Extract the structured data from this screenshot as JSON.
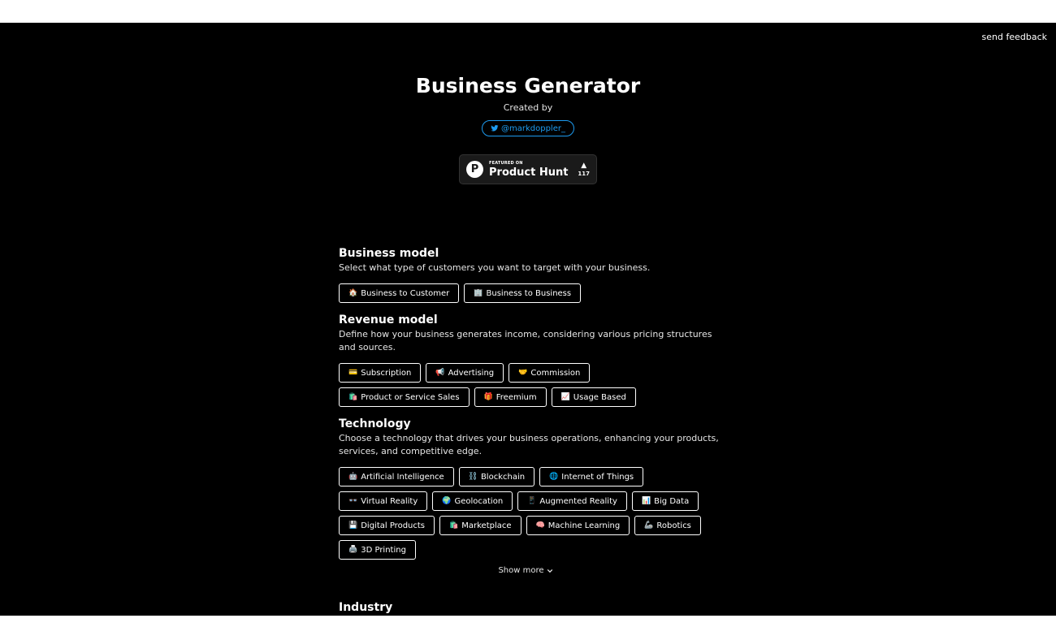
{
  "header": {
    "feedback": "send feedback",
    "title": "Business Generator",
    "created_by": "Created by",
    "twitter_handle": "@markdoppler_"
  },
  "product_hunt": {
    "small": "FEATURED ON",
    "big": "Product Hunt",
    "logo_letter": "P",
    "arrow": "▲",
    "votes": "117"
  },
  "sections": {
    "business_model": {
      "title": "Business model",
      "description": "Select what type of customers you want to target with your business.",
      "options": [
        {
          "icon": "🏠",
          "icon_name": "house-icon",
          "label": "Business to Customer"
        },
        {
          "icon": "🏢",
          "icon_name": "office-building-icon",
          "label": "Business to Business"
        }
      ]
    },
    "revenue_model": {
      "title": "Revenue model",
      "description": "Define how your business generates income, considering various pricing structures and sources.",
      "options": [
        {
          "icon": "💳",
          "icon_name": "credit-card-icon",
          "label": "Subscription"
        },
        {
          "icon": "📢",
          "icon_name": "megaphone-icon",
          "label": "Advertising"
        },
        {
          "icon": "🤝",
          "icon_name": "handshake-icon",
          "label": "Commission"
        },
        {
          "icon": "🛍️",
          "icon_name": "shopping-bags-icon",
          "label": "Product or Service Sales"
        },
        {
          "icon": "🎁",
          "icon_name": "gift-icon",
          "label": "Freemium"
        },
        {
          "icon": "📈",
          "icon_name": "chart-up-icon",
          "label": "Usage Based"
        }
      ]
    },
    "technology": {
      "title": "Technology",
      "description": "Choose a technology that drives your business operations, enhancing your products, services, and competitive edge.",
      "options": [
        {
          "icon": "🤖",
          "icon_name": "robot-icon",
          "label": "Artificial Intelligence"
        },
        {
          "icon": "⛓️",
          "icon_name": "chain-icon",
          "label": "Blockchain"
        },
        {
          "icon": "🌐",
          "icon_name": "globe-icon",
          "label": "Internet of Things"
        },
        {
          "icon": "👓",
          "icon_name": "glasses-icon",
          "label": "Virtual Reality"
        },
        {
          "icon": "🌍",
          "icon_name": "earth-icon",
          "label": "Geolocation"
        },
        {
          "icon": "📱",
          "icon_name": "phone-icon",
          "label": "Augmented Reality"
        },
        {
          "icon": "📊",
          "icon_name": "bar-chart-icon",
          "label": "Big Data"
        },
        {
          "icon": "💾",
          "icon_name": "floppy-disk-icon",
          "label": "Digital Products"
        },
        {
          "icon": "🛍️",
          "icon_name": "shopping-bags-icon",
          "label": "Marketplace"
        },
        {
          "icon": "🧠",
          "icon_name": "brain-icon",
          "label": "Machine Learning"
        },
        {
          "icon": "🦾",
          "icon_name": "mechanical-arm-icon",
          "label": "Robotics"
        },
        {
          "icon": "🖨️",
          "icon_name": "printer-icon",
          "label": "3D Printing"
        }
      ],
      "show_more": "Show more"
    },
    "industry": {
      "title": "Industry"
    }
  },
  "colors": {
    "background": "#000000",
    "text": "#ffffff",
    "twitter": "#1d9bf0"
  }
}
